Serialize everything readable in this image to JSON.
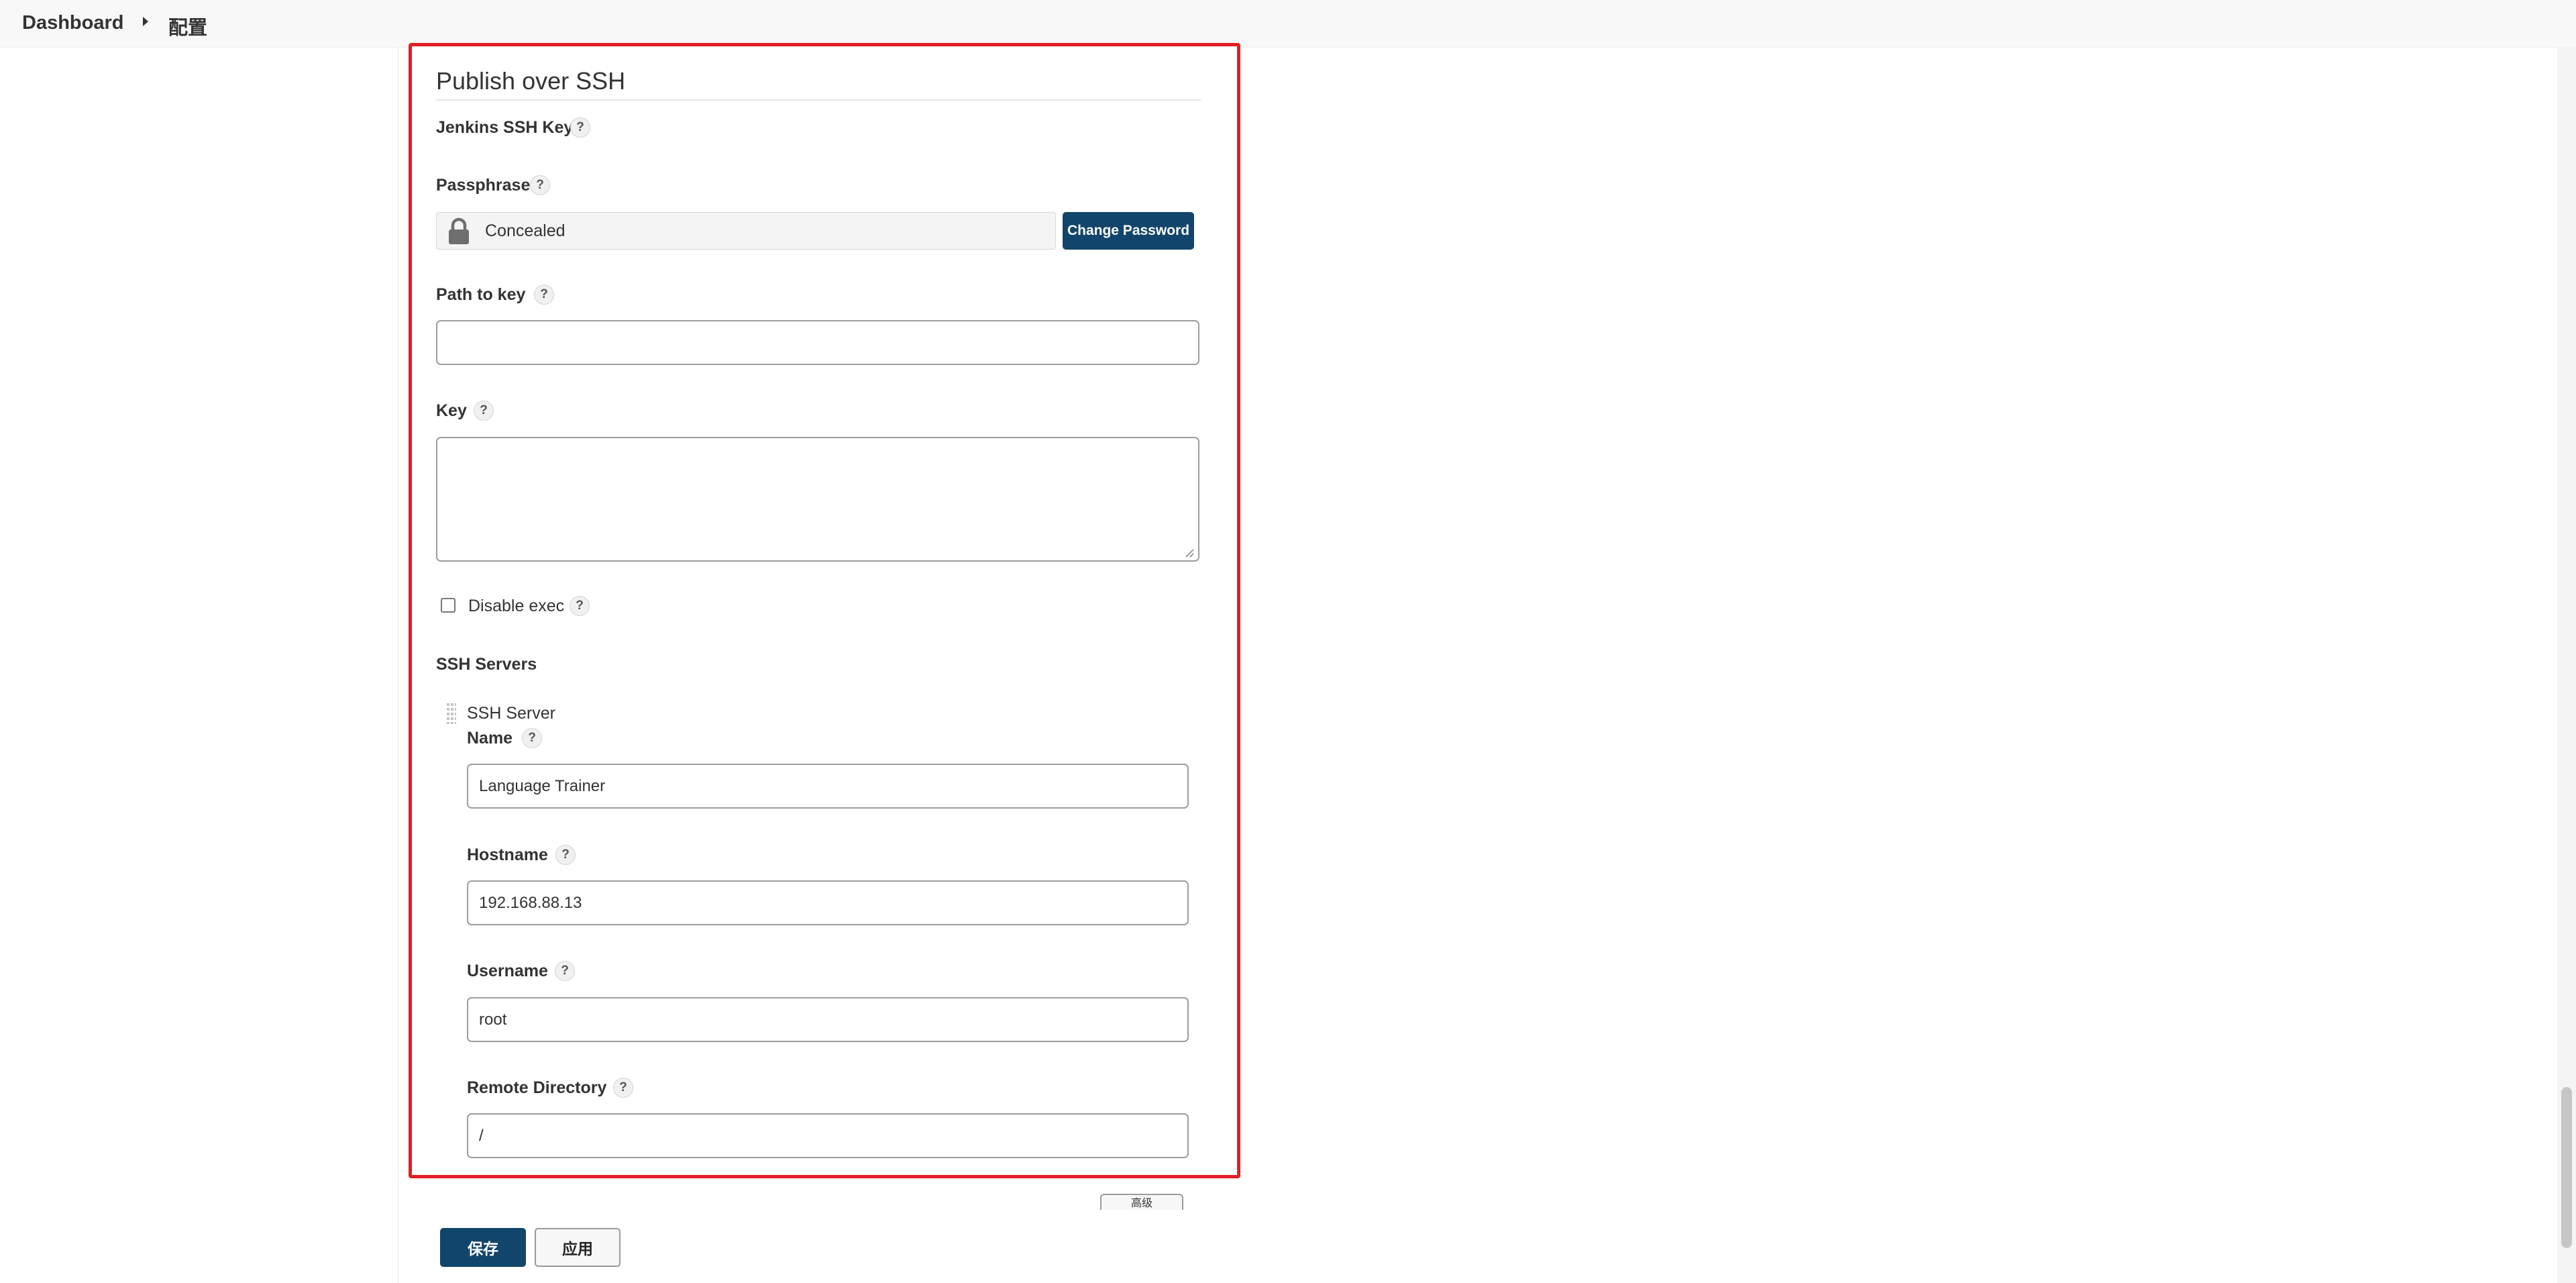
{
  "breadcrumb": {
    "home": "Dashboard",
    "current": "配置"
  },
  "section": {
    "title": "Publish over SSH"
  },
  "help_glyph": "?",
  "jenkins_ssh_key": {
    "label": "Jenkins SSH Key"
  },
  "passphrase": {
    "label": "Passphrase",
    "value": "Concealed",
    "change_button": "Change Password"
  },
  "path_to_key": {
    "label": "Path to key",
    "value": ""
  },
  "key": {
    "label": "Key",
    "value": ""
  },
  "disable_exec": {
    "label": "Disable exec",
    "checked": false
  },
  "ssh_servers": {
    "label": "SSH Servers",
    "server": {
      "title": "SSH Server",
      "name": {
        "label": "Name",
        "value": "Language Trainer"
      },
      "hostname": {
        "label": "Hostname",
        "value": "192.168.88.13"
      },
      "username": {
        "label": "Username",
        "value": "root"
      },
      "remote_directory": {
        "label": "Remote Directory",
        "value": "/"
      }
    }
  },
  "partial_button": "高级",
  "footer": {
    "save": "保存",
    "apply": "应用"
  },
  "colors": {
    "primary": "#12456b",
    "highlight": "#e31e24"
  }
}
